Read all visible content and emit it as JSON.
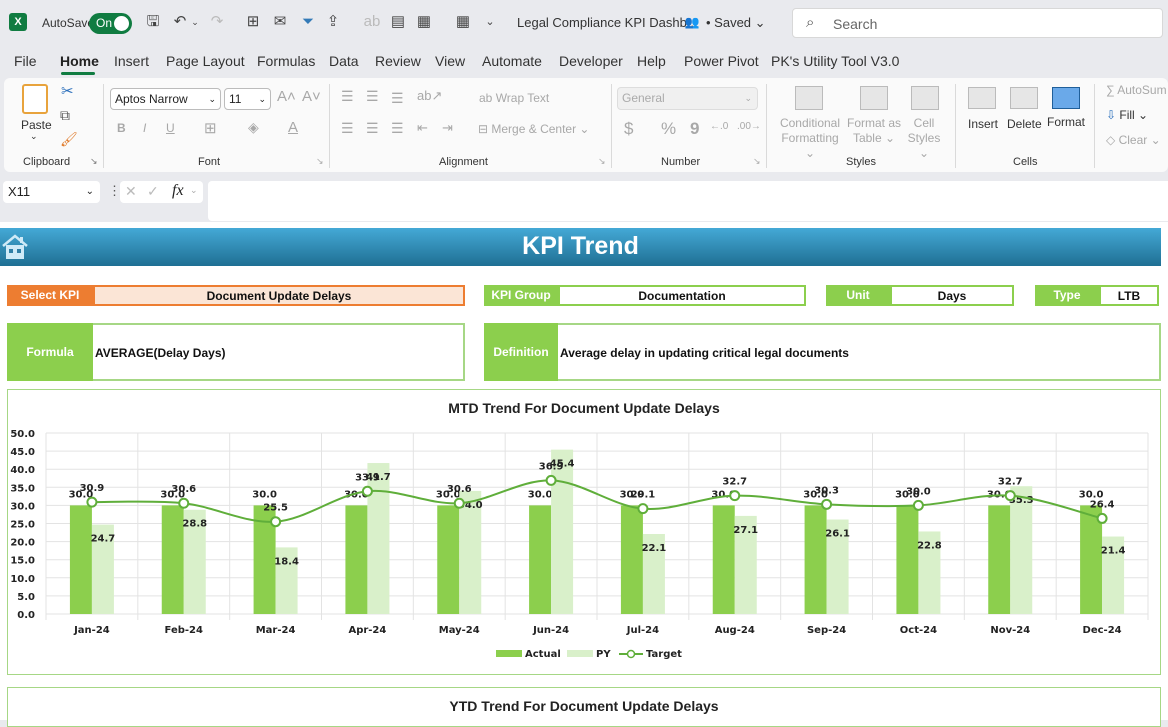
{
  "titlebar": {
    "app_icon": "excel-logo-icon",
    "autosave_label": "AutoSave",
    "autosave_state": "On",
    "quick_access_icons": [
      "save-icon",
      "undo-icon",
      "redo-icon",
      "borders-icon",
      "paperclip-icon",
      "filter-icon",
      "share-icon",
      "spelling-icon",
      "table-icon",
      "calculator-icon",
      "calculator-icon",
      "more-icon"
    ],
    "document_title": "Legal Compliance KPI Dashb...",
    "save_status": "• Saved",
    "search_placeholder": "Search"
  },
  "ribbon_tabs": [
    "File",
    "Home",
    "Insert",
    "Page Layout",
    "Formulas",
    "Data",
    "Review",
    "View",
    "Automate",
    "Developer",
    "Help",
    "Power Pivot",
    "PK's Utility Tool V3.0"
  ],
  "active_tab": "Home",
  "ribbon": {
    "clipboard": {
      "label": "Clipboard",
      "paste": "Paste"
    },
    "font": {
      "label": "Font",
      "font_name": "Aptos Narrow",
      "font_size": "11",
      "bold": "B",
      "italic": "I",
      "underline": "U"
    },
    "alignment": {
      "label": "Alignment",
      "wrap_text": "Wrap Text",
      "merge_center": "Merge & Center"
    },
    "number": {
      "label": "Number",
      "format": "General",
      "currency": "$",
      "percent": "%",
      "comma": "9"
    },
    "styles": {
      "label": "Styles",
      "conditional_1": "Conditional",
      "conditional_2": "Formatting",
      "format_table_1": "Format as",
      "format_table_2": "Table",
      "cell_styles_1": "Cell",
      "cell_styles_2": "Styles"
    },
    "cells": {
      "label": "Cells",
      "insert": "Insert",
      "delete": "Delete",
      "format": "Format"
    },
    "editing": {
      "autosum": "AutoSum",
      "fill": "Fill",
      "clear": "Clear"
    }
  },
  "formula_bar": {
    "name_box": "X11",
    "fx": "fx",
    "formula": ""
  },
  "dashboard": {
    "banner_title": "KPI Trend",
    "select_kpi_label": "Select KPI",
    "select_kpi_value": "Document Update Delays",
    "kpi_group_label": "KPI Group",
    "kpi_group_value": "Documentation",
    "unit_label": "Unit",
    "unit_value": "Days",
    "type_label": "Type",
    "type_value": "LTB",
    "formula_label": "Formula",
    "formula_value": "AVERAGE(Delay Days)",
    "definition_label": "Definition",
    "definition_value": "Average delay in updating critical legal documents",
    "ytd_title": "YTD Trend For Document Update Delays"
  },
  "colors": {
    "orange": "#ed7d31",
    "green": "#8ccf4d",
    "actual": "#8ccf4d",
    "py": "#d9f0ca",
    "target": "#5fae3a",
    "banner": "#2b86b3"
  },
  "chart_data": {
    "type": "bar",
    "title": "MTD Trend For Document Update Delays",
    "categories": [
      "Jan-24",
      "Feb-24",
      "Mar-24",
      "Apr-24",
      "May-24",
      "Jun-24",
      "Jul-24",
      "Aug-24",
      "Sep-24",
      "Oct-24",
      "Nov-24",
      "Dec-24"
    ],
    "series": [
      {
        "name": "Actual",
        "kind": "bar",
        "values": [
          30.0,
          30.0,
          30.0,
          30.0,
          30.0,
          30.0,
          30.0,
          30.0,
          30.0,
          30.0,
          30.0,
          30.0
        ]
      },
      {
        "name": "PY",
        "kind": "bar",
        "values": [
          24.7,
          28.8,
          18.4,
          41.7,
          34.0,
          45.4,
          22.1,
          27.1,
          26.1,
          22.8,
          35.3,
          21.4
        ]
      },
      {
        "name": "Target",
        "kind": "line",
        "values": [
          30.9,
          30.6,
          25.5,
          33.9,
          30.6,
          36.9,
          29.1,
          32.7,
          30.3,
          30.0,
          32.7,
          26.4
        ]
      }
    ],
    "yticks": [
      "0.0",
      "5.0",
      "10.0",
      "15.0",
      "20.0",
      "25.0",
      "30.0",
      "35.0",
      "40.0",
      "45.0",
      "50.0"
    ],
    "ylim": [
      0,
      50
    ],
    "xlabel": "",
    "ylabel": "",
    "grid": true,
    "legend": "bottom"
  }
}
